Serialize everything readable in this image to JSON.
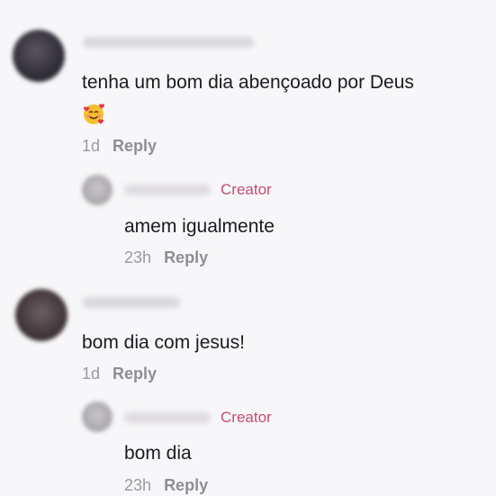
{
  "comments": [
    {
      "text": "tenha um bom dia abençoado por Deus",
      "emoji": "smiling-face-with-hearts",
      "time": "1d",
      "reply_label": "Reply",
      "reply": {
        "badge": "Creator",
        "text": "amem igualmente",
        "time": "23h",
        "reply_label": "Reply"
      }
    },
    {
      "text": "bom dia com jesus!",
      "time": "1d",
      "reply_label": "Reply",
      "reply": {
        "badge": "Creator",
        "text": "bom dia",
        "time": "23h",
        "reply_label": "Reply"
      }
    }
  ],
  "colors": {
    "background": "#f7f6f8",
    "creator_badge": "#c64a76",
    "meta": "#9a9aa0"
  }
}
